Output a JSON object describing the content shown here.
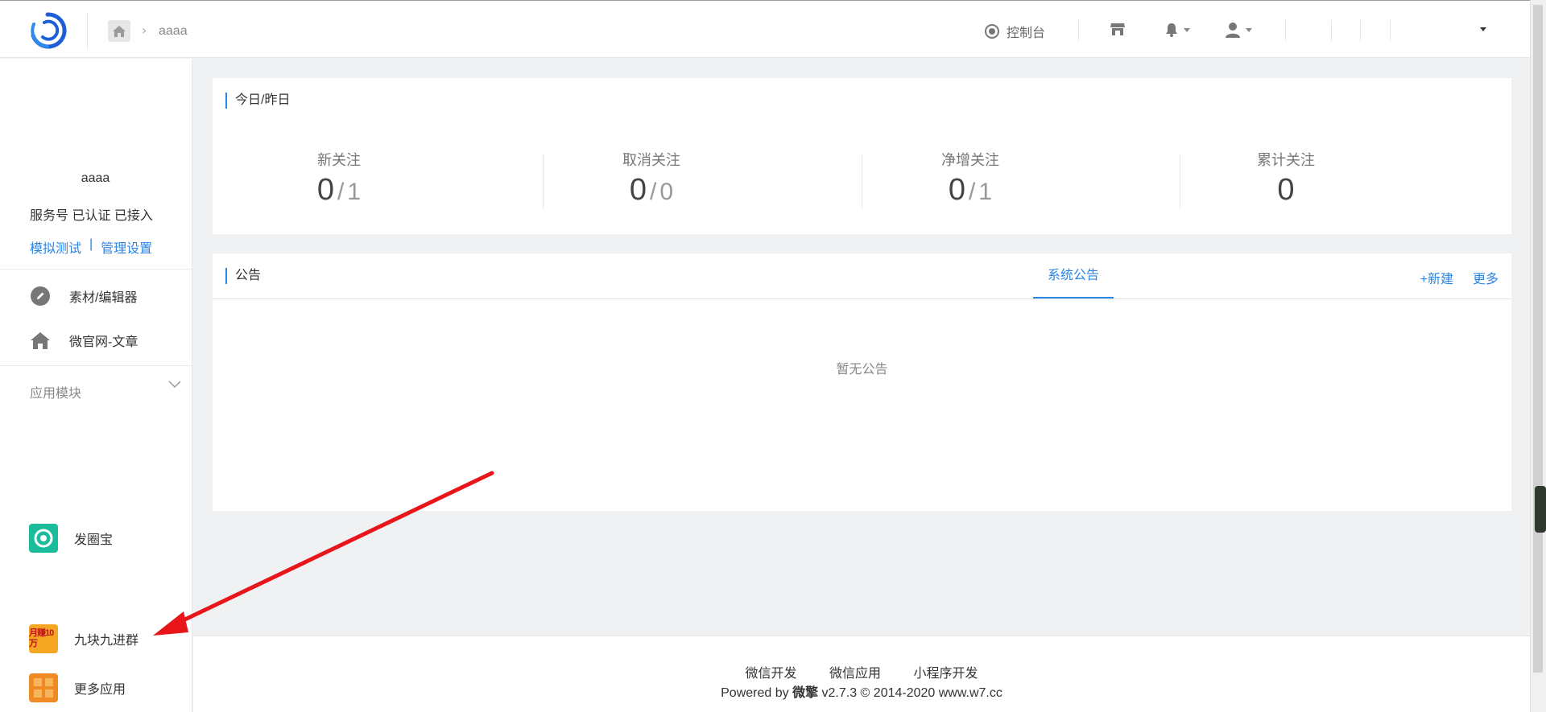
{
  "header": {
    "breadcrumb_current": "aaaa",
    "console_label": "控制台"
  },
  "account": {
    "name": "aaaa",
    "type_line": "服务号 已认证 已接入",
    "link_test": "模拟测试",
    "link_sep": "|",
    "link_settings": "管理设置"
  },
  "sidebar": {
    "items": [
      {
        "label": "素材/编辑器",
        "icon": "edit-icon"
      },
      {
        "label": "微官网-文章",
        "icon": "home-icon"
      }
    ],
    "section_title": "应用模块",
    "apps": [
      {
        "label": "发圈宝",
        "icon": "camera-app-icon"
      },
      {
        "label": "九块九进群",
        "icon": "app-badge-icon",
        "badge_text": "月赚10万"
      },
      {
        "label": "更多应用",
        "icon": "more-apps-icon"
      }
    ]
  },
  "stats": {
    "title": "今日/昨日",
    "items": [
      {
        "label": "新关注",
        "today": "0",
        "yesterday": "1"
      },
      {
        "label": "取消关注",
        "today": "0",
        "yesterday": "0"
      },
      {
        "label": "净增关注",
        "today": "0",
        "yesterday": "1"
      },
      {
        "label": "累计关注",
        "today": "0",
        "yesterday": ""
      }
    ]
  },
  "notice": {
    "title": "公告",
    "tab": "系统公告",
    "new_label": "+新建",
    "more_label": "更多",
    "empty_text": "暂无公告"
  },
  "footer": {
    "links": [
      "微信开发",
      "微信应用",
      "小程序开发"
    ],
    "copyright_prefix": "Powered by ",
    "brand": "微擎",
    "copyright_suffix": " v2.7.3 © 2014-2020 www.w7.cc"
  },
  "colors": {
    "accent": "#2b85e4",
    "annotation_arrow": "#e8151a",
    "app_green": "#1abc9c",
    "app_orange": "#f5a623"
  }
}
